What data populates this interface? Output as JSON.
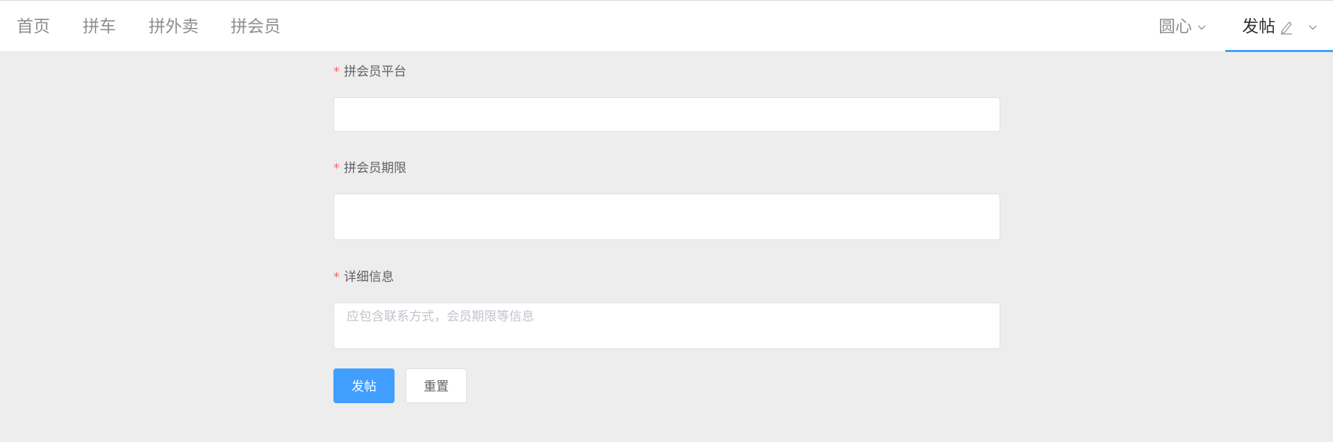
{
  "nav": {
    "items": [
      {
        "label": "首页"
      },
      {
        "label": "拼车"
      },
      {
        "label": "拼外卖"
      },
      {
        "label": "拼会员"
      }
    ],
    "user_menu": {
      "label": "圆心",
      "icon": "chevron-down-icon"
    },
    "post_menu": {
      "label": "发帖",
      "icon": "edit-icon",
      "caret_icon": "chevron-down-icon",
      "active_color": "#409eff"
    }
  },
  "form": {
    "required_mark": "*",
    "platform": {
      "label": "拼会员平台",
      "value": ""
    },
    "duration": {
      "label": "拼会员期限",
      "value": ""
    },
    "details": {
      "label": "详细信息",
      "value": "",
      "placeholder": "应包含联系方式，会员期限等信息"
    },
    "submit_label": "发帖",
    "reset_label": "重置"
  },
  "colors": {
    "primary": "#409eff",
    "required": "#f56c6c",
    "background": "#ededed"
  }
}
